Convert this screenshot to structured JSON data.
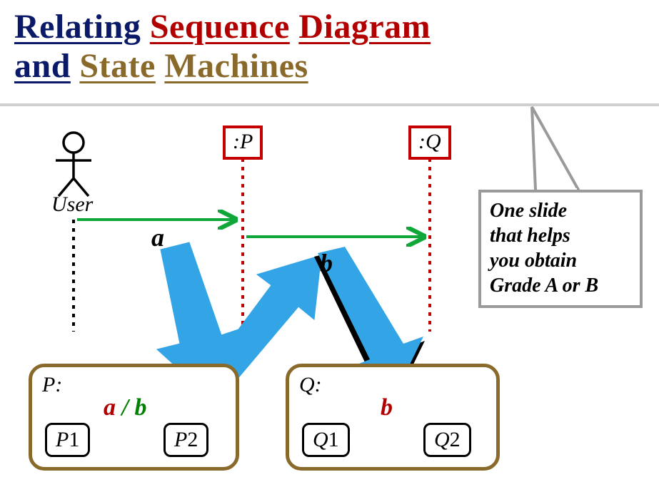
{
  "title": {
    "word1": "Relating",
    "word2": "Sequence",
    "word3": "Diagram",
    "word4": "and",
    "word5": "State",
    "word6": "Machines"
  },
  "callout": {
    "line1": "One slide",
    "line2": "that helps",
    "line3": "you obtain",
    "line4": "Grade A or B"
  },
  "sequence": {
    "actor_label": "User",
    "lifeline_p": ":P",
    "lifeline_q": ":Q",
    "msg_a": "a",
    "msg_b": "b"
  },
  "state_machines": {
    "p": {
      "title": "P:",
      "s1_letter": "P",
      "s1_num": "1",
      "s2_letter": "P",
      "s2_num": "2",
      "trans_a": "a",
      "trans_sep": "/",
      "trans_b": "b"
    },
    "q": {
      "title": "Q:",
      "s1_letter": "Q",
      "s1_num": "1",
      "s2_letter": "Q",
      "s2_num": "2",
      "trans_b": "b"
    }
  }
}
